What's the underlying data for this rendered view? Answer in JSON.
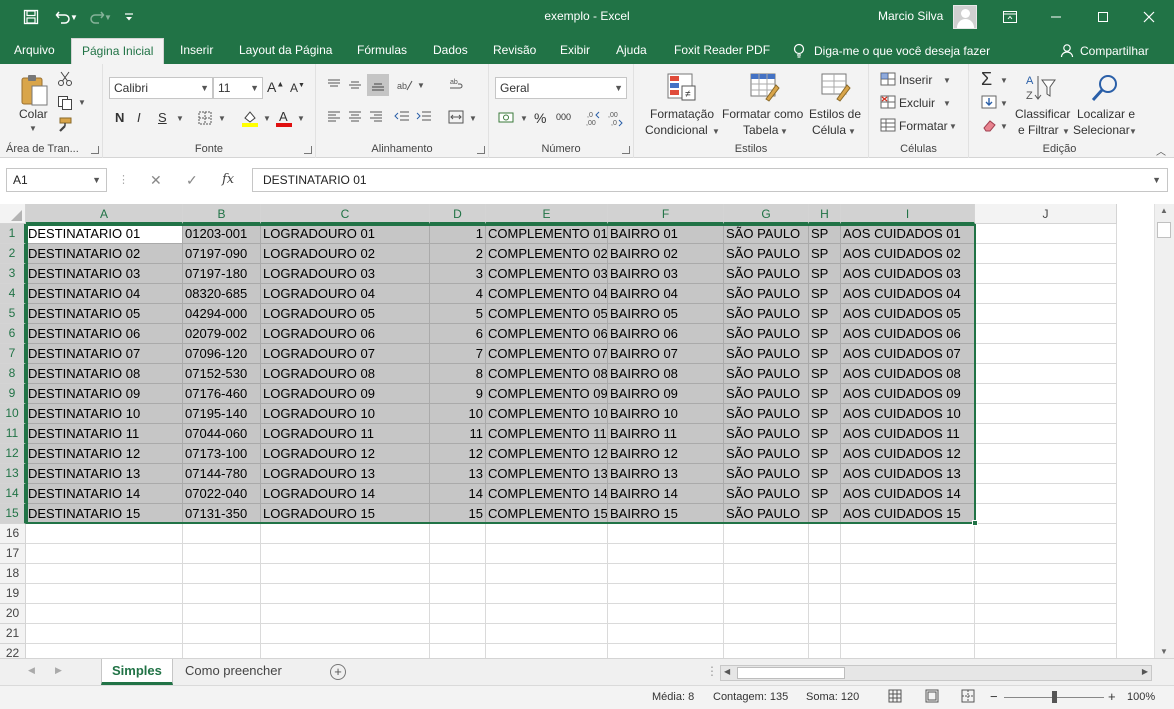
{
  "window": {
    "title": "exemplo  -  Excel",
    "user_name": "Marcio Silva"
  },
  "colors": {
    "accent": "#217346",
    "selection_fill": "#c6c6c6"
  },
  "tabs": [
    {
      "label": "Arquivo"
    },
    {
      "label": "Página Inicial"
    },
    {
      "label": "Inserir"
    },
    {
      "label": "Layout da Página"
    },
    {
      "label": "Fórmulas"
    },
    {
      "label": "Dados"
    },
    {
      "label": "Revisão"
    },
    {
      "label": "Exibir"
    },
    {
      "label": "Ajuda"
    },
    {
      "label": "Foxit Reader PDF"
    }
  ],
  "tellme": "Diga-me o que você deseja fazer",
  "share": "Compartilhar",
  "ribbon": {
    "clipboard": {
      "label": "Área de Tran...",
      "paste": "Colar"
    },
    "font": {
      "label": "Fonte",
      "font_name": "Calibri",
      "font_size": "11",
      "bold": "N",
      "italic": "I",
      "underline": "S"
    },
    "alignment": {
      "label": "Alinhamento"
    },
    "number": {
      "label": "Número",
      "format": "Geral",
      "percent": "%",
      "thousands": "000"
    },
    "styles": {
      "label": "Estilos",
      "cond_fmt_1": "Formatação",
      "cond_fmt_2": "Condicional",
      "table_fmt_1": "Formatar como",
      "table_fmt_2": "Tabela",
      "cell_styles_1": "Estilos de",
      "cell_styles_2": "Célula"
    },
    "cells": {
      "label": "Células",
      "insert": "Inserir",
      "delete": "Excluir",
      "format": "Formatar"
    },
    "editing": {
      "label": "Edição",
      "sort_1": "Classificar",
      "sort_2": "e Filtrar",
      "find_1": "Localizar e",
      "find_2": "Selecionar"
    }
  },
  "formula_bar": {
    "name_box": "A1",
    "fx": "fx",
    "content": "DESTINATARIO 01"
  },
  "columns": [
    "A",
    "B",
    "C",
    "D",
    "E",
    "F",
    "G",
    "H",
    "I",
    "J"
  ],
  "rows": [
    [
      "DESTINATARIO 01",
      "01203-001",
      "LOGRADOURO 01",
      "1",
      "COMPLEMENTO 01",
      "BAIRRO 01",
      "SÃO PAULO",
      "SP",
      "AOS CUIDADOS 01"
    ],
    [
      "DESTINATARIO 02",
      "07197-090",
      "LOGRADOURO 02",
      "2",
      "COMPLEMENTO 02",
      "BAIRRO 02",
      "SÃO PAULO",
      "SP",
      "AOS CUIDADOS 02"
    ],
    [
      "DESTINATARIO 03",
      "07197-180",
      "LOGRADOURO 03",
      "3",
      "COMPLEMENTO 03",
      "BAIRRO 03",
      "SÃO PAULO",
      "SP",
      "AOS CUIDADOS 03"
    ],
    [
      "DESTINATARIO 04",
      "08320-685",
      "LOGRADOURO 04",
      "4",
      "COMPLEMENTO 04",
      "BAIRRO 04",
      "SÃO PAULO",
      "SP",
      "AOS CUIDADOS 04"
    ],
    [
      "DESTINATARIO 05",
      "04294-000",
      "LOGRADOURO 05",
      "5",
      "COMPLEMENTO 05",
      "BAIRRO 05",
      "SÃO PAULO",
      "SP",
      "AOS CUIDADOS 05"
    ],
    [
      "DESTINATARIO 06",
      "02079-002",
      "LOGRADOURO 06",
      "6",
      "COMPLEMENTO 06",
      "BAIRRO 06",
      "SÃO PAULO",
      "SP",
      "AOS CUIDADOS 06"
    ],
    [
      "DESTINATARIO 07",
      "07096-120",
      "LOGRADOURO 07",
      "7",
      "COMPLEMENTO 07",
      "BAIRRO 07",
      "SÃO PAULO",
      "SP",
      "AOS CUIDADOS 07"
    ],
    [
      "DESTINATARIO 08",
      "07152-530",
      "LOGRADOURO 08",
      "8",
      "COMPLEMENTO 08",
      "BAIRRO 08",
      "SÃO PAULO",
      "SP",
      "AOS CUIDADOS 08"
    ],
    [
      "DESTINATARIO 09",
      "07176-460",
      "LOGRADOURO 09",
      "9",
      "COMPLEMENTO 09",
      "BAIRRO 09",
      "SÃO PAULO",
      "SP",
      "AOS CUIDADOS 09"
    ],
    [
      "DESTINATARIO 10",
      "07195-140",
      "LOGRADOURO 10",
      "10",
      "COMPLEMENTO 10",
      "BAIRRO 10",
      "SÃO PAULO",
      "SP",
      "AOS CUIDADOS 10"
    ],
    [
      "DESTINATARIO 11",
      "07044-060",
      "LOGRADOURO 11",
      "11",
      "COMPLEMENTO 11",
      "BAIRRO 11",
      "SÃO PAULO",
      "SP",
      "AOS CUIDADOS 11"
    ],
    [
      "DESTINATARIO 12",
      "07173-100",
      "LOGRADOURO 12",
      "12",
      "COMPLEMENTO 12",
      "BAIRRO 12",
      "SÃO PAULO",
      "SP",
      "AOS CUIDADOS 12"
    ],
    [
      "DESTINATARIO 13",
      "07144-780",
      "LOGRADOURO 13",
      "13",
      "COMPLEMENTO 13",
      "BAIRRO 13",
      "SÃO PAULO",
      "SP",
      "AOS CUIDADOS 13"
    ],
    [
      "DESTINATARIO 14",
      "07022-040",
      "LOGRADOURO 14",
      "14",
      "COMPLEMENTO 14",
      "BAIRRO 14",
      "SÃO PAULO",
      "SP",
      "AOS CUIDADOS 14"
    ],
    [
      "DESTINATARIO 15",
      "07131-350",
      "LOGRADOURO 15",
      "15",
      "COMPLEMENTO 15",
      "BAIRRO 15",
      "SÃO PAULO",
      "SP",
      "AOS CUIDADOS 15"
    ]
  ],
  "row_numbers": [
    "1",
    "2",
    "3",
    "4",
    "5",
    "6",
    "7",
    "8",
    "9",
    "10",
    "11",
    "12",
    "13",
    "14",
    "15",
    "16",
    "17",
    "18",
    "19",
    "20",
    "21",
    "22"
  ],
  "sheets": [
    "Simples",
    "Como preencher"
  ],
  "status": {
    "average": "Média: 8",
    "count": "Contagem: 135",
    "sum": "Soma: 120",
    "zoom": "100%"
  }
}
